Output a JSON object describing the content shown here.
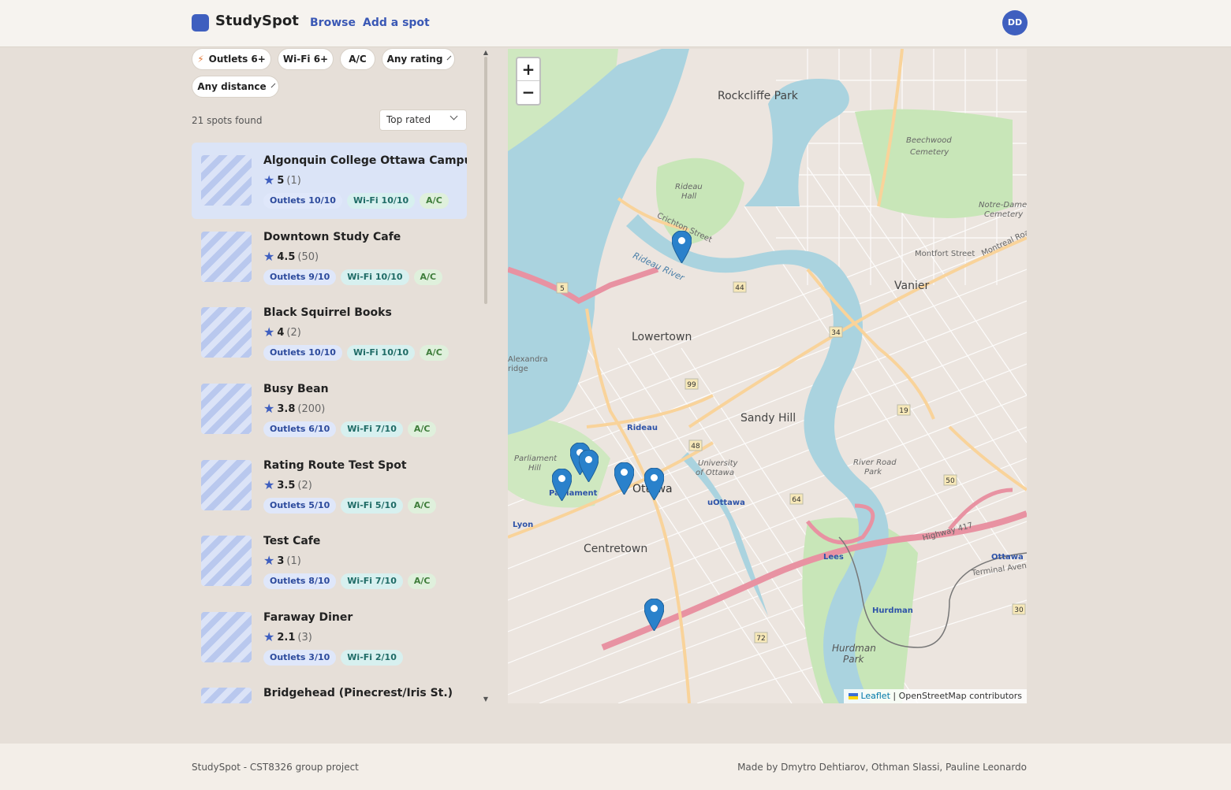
{
  "header": {
    "brand": "StudySpot",
    "nav": [
      "Browse",
      "Add a spot"
    ],
    "avatar_initials": "DD",
    "accent": "#3f5fbf"
  },
  "filters": {
    "chips": [
      "Outlets 6+",
      "Wi-Fi 6+",
      "A/C"
    ],
    "rating": "Any rating",
    "distance": "Any distance",
    "icons": {
      "outlets": "bolt-icon",
      "dropdown": "chevron-down-icon"
    }
  },
  "results": {
    "count_text": "21 spots found",
    "sort": "Top rated"
  },
  "spots": [
    {
      "name": "Algonquin College Ottawa Campus",
      "rating": "5",
      "reviews": "(1)",
      "outlets": "Outlets 10/10",
      "wifi": "Wi-Fi 10/10",
      "ac": "A/C",
      "active": true
    },
    {
      "name": "Downtown Study Cafe",
      "rating": "4.5",
      "reviews": "(50)",
      "outlets": "Outlets 9/10",
      "wifi": "Wi-Fi 10/10",
      "ac": "A/C"
    },
    {
      "name": "Black Squirrel Books",
      "rating": "4",
      "reviews": "(2)",
      "outlets": "Outlets 10/10",
      "wifi": "Wi-Fi 10/10",
      "ac": "A/C"
    },
    {
      "name": "Busy Bean",
      "rating": "3.8",
      "reviews": "(200)",
      "outlets": "Outlets 6/10",
      "wifi": "Wi-Fi 7/10",
      "ac": "A/C"
    },
    {
      "name": "Rating Route Test Spot",
      "rating": "3.5",
      "reviews": "(2)",
      "outlets": "Outlets 5/10",
      "wifi": "Wi-Fi 5/10",
      "ac": "A/C"
    },
    {
      "name": "Test Cafe",
      "rating": "3",
      "reviews": "(1)",
      "outlets": "Outlets 8/10",
      "wifi": "Wi-Fi 7/10",
      "ac": "A/C"
    },
    {
      "name": "Faraway Diner",
      "rating": "2.1",
      "reviews": "(3)",
      "outlets": "Outlets 3/10",
      "wifi": "Wi-Fi 2/10",
      "ac": ""
    },
    {
      "name": "Bridgehead (Pinecrest/Iris St.)",
      "rating": "",
      "reviews": "",
      "outlets": "",
      "wifi": "",
      "ac": ""
    }
  ],
  "map": {
    "zoom_in": "+",
    "zoom_out": "−",
    "attribution_link": "Leaflet",
    "attribution_text": "| OpenStreetMap contributors",
    "labels": {
      "rockcliffe": "Rockcliffe Park",
      "beechwood_1": "Beechwood",
      "beechwood_2": "Cemetery",
      "notre_dame_1": "Notre-Dame",
      "notre_dame_2": "Cemetery",
      "vanier": "Vanier",
      "lowertown": "Lowertown",
      "sandy_hill": "Sandy Hill",
      "centretown": "Centretown",
      "ottawa": "Ottawa",
      "parliament": "Parliament",
      "rideau": "Rideau",
      "uottawa": "uOttawa",
      "lees": "Lees",
      "hurdman": "Hurdman",
      "hurdman_park_1": "Hurdman",
      "hurdman_park_2": "Park",
      "lyon": "Lyon",
      "ottawa_station": "Ottawa",
      "rideau_hall_1": "Rideau",
      "rideau_hall_2": "Hall",
      "univ_1": "University",
      "univ_2": "of Ottawa",
      "river_road_1": "River Road",
      "river_road_2": "Park",
      "alexandra_1": "Alexandra",
      "alexandra_2": "ridge",
      "parliament_hill_1": "Parliament",
      "parliament_hill_2": "Hill",
      "montfort": "Montfort Street",
      "montreal": "Montreal Road",
      "highway417": "Highway 417",
      "terminal": "Terminal Avenue",
      "crichton": "Crichton Street",
      "rideau_river": "Rideau River"
    },
    "shields": [
      "5",
      "44",
      "34",
      "99",
      "48",
      "19",
      "50",
      "64",
      "72",
      "30"
    ],
    "colors": {
      "water": "#aad3df",
      "park": "#c8e6b8",
      "highway": "#e892a2",
      "major": "#f9d39a",
      "urban": "#e6d6d1"
    }
  },
  "footer": {
    "left": "StudySpot - CST8326 group project",
    "right": "Made by Dmytro Dehtiarov, Othman Slassi, Pauline Leonardo"
  }
}
